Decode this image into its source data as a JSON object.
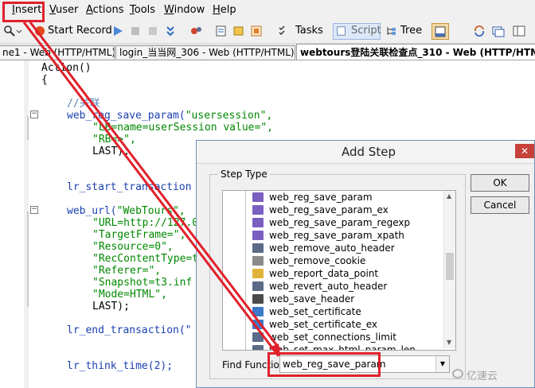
{
  "menubar": {
    "items": [
      {
        "label": "Insert",
        "u": "I"
      },
      {
        "label": "Vuser",
        "u": "V"
      },
      {
        "label": "Actions",
        "u": "A"
      },
      {
        "label": "Tools",
        "u": "T"
      },
      {
        "label": "Window",
        "u": "W"
      },
      {
        "label": "Help",
        "u": "H"
      }
    ]
  },
  "toolbar": {
    "start_record": "Start Record",
    "tasks": "Tasks",
    "script": "Script",
    "tree": "Tree"
  },
  "tabs": [
    {
      "label": "ne1 - Web (HTTP/HTML)"
    },
    {
      "label": "login_当当网_306 - Web (HTTP/HTML)"
    },
    {
      "label": "webtours登陆关联检查点_310 - Web (HTTP/HTML)"
    }
  ],
  "code": {
    "l1": "Action()",
    "l2": "{",
    "comment": "//关联",
    "reg_fn": "web_reg_save_param(",
    "reg_arg1": "\"usersession\",",
    "reg_arg2": "\"LB=name=userSession value=\",",
    "reg_arg3": "\"RB=>\",",
    "reg_last": "LAST);",
    "start_tx": "lr_start_transaction",
    "url_fn": "web_url(",
    "url_arg0": "\"WebTours\",",
    "url_arg1": "\"URL=http://127.0",
    "url_arg2": "\"TargetFrame=\",",
    "url_arg3": "\"Resource=0\",",
    "url_arg4": "\"RecContentType=t",
    "url_arg5": "\"Referer=\",",
    "url_arg6": "\"Snapshot=t3.inf",
    "url_arg7": "\"Mode=HTML\",",
    "url_last": "LAST);",
    "end_tx": "lr_end_transaction(\"",
    "think": "lr_think_time(2);"
  },
  "dialog": {
    "title": "Add Step",
    "close": "✕",
    "group_label": "Step Type",
    "items": [
      "web_reg_save_param",
      "web_reg_save_param_ex",
      "web_reg_save_param_regexp",
      "web_reg_save_param_xpath",
      "web_remove_auto_header",
      "web_remove_cookie",
      "web_report_data_point",
      "web_revert_auto_header",
      "web_save_header",
      "web_set_certificate",
      "web_set_certificate_ex",
      "web_set_connections_limit",
      "web_set_max_html_param_len"
    ],
    "find_label": "Find Function:",
    "find_value": "web_reg_save_param",
    "ok": "OK",
    "cancel": "Cancel"
  },
  "colors": {
    "highlight": "#e0202a",
    "string": "#008800",
    "function": "#1a3fae",
    "comment": "#5b82b5"
  },
  "watermark": "亿速云"
}
